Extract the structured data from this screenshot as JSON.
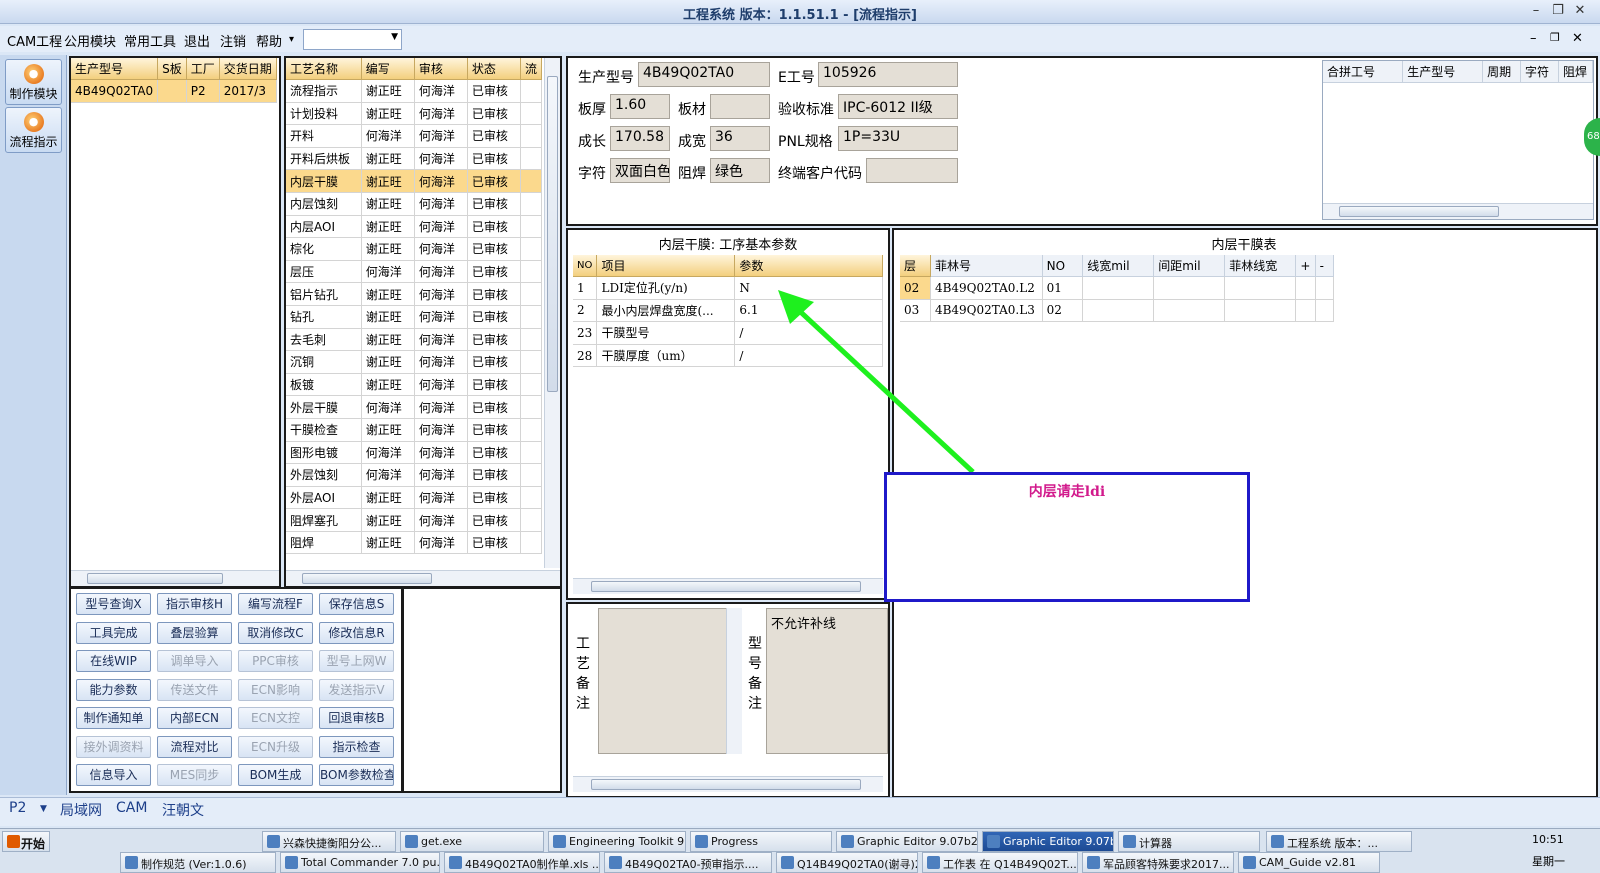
{
  "window": {
    "title": "工程系统   版本：1.1.51.1 - [流程指示]",
    "minimize": "–",
    "restore": "❐",
    "close": "✕"
  },
  "menu": {
    "items": [
      "CAM工程",
      "公用模块",
      "常用工具",
      "退出",
      "注销",
      "帮助"
    ],
    "dropdown_arrow": "▾",
    "combo_value": "",
    "mdi_min": "–",
    "mdi_restore": "❐",
    "mdi_close": "✕"
  },
  "sidebar": {
    "buttons": [
      {
        "label": "制作模块",
        "icon": "flame-icon"
      },
      {
        "label": "流程指示",
        "icon": "flow-icon"
      }
    ]
  },
  "orders": {
    "columns": [
      "生产型号",
      "S板",
      "工厂",
      "交货日期"
    ],
    "rows": [
      {
        "model": "4B49Q02TA0",
        "s": "",
        "factory": "P2",
        "date": "2017/3"
      }
    ]
  },
  "process": {
    "columns": [
      "工艺名称",
      "编写",
      "审核",
      "状态",
      "流"
    ],
    "rows": [
      [
        "流程指示",
        "谢正旺",
        "何海洋",
        "已审核"
      ],
      [
        "计划投料",
        "谢正旺",
        "何海洋",
        "已审核"
      ],
      [
        "开料",
        "何海洋",
        "何海洋",
        "已审核"
      ],
      [
        "开料后烘板",
        "谢正旺",
        "何海洋",
        "已审核"
      ],
      [
        "内层干膜",
        "谢正旺",
        "何海洋",
        "已审核"
      ],
      [
        "内层蚀刻",
        "谢正旺",
        "何海洋",
        "已审核"
      ],
      [
        "内层AOI",
        "谢正旺",
        "何海洋",
        "已审核"
      ],
      [
        "棕化",
        "谢正旺",
        "何海洋",
        "已审核"
      ],
      [
        "层压",
        "何海洋",
        "何海洋",
        "已审核"
      ],
      [
        "铝片钻孔",
        "谢正旺",
        "何海洋",
        "已审核"
      ],
      [
        "钻孔",
        "谢正旺",
        "何海洋",
        "已审核"
      ],
      [
        "去毛刺",
        "谢正旺",
        "何海洋",
        "已审核"
      ],
      [
        "沉铜",
        "谢正旺",
        "何海洋",
        "已审核"
      ],
      [
        "板镀",
        "谢正旺",
        "何海洋",
        "已审核"
      ],
      [
        "外层干膜",
        "何海洋",
        "何海洋",
        "已审核"
      ],
      [
        "干膜检查",
        "谢正旺",
        "何海洋",
        "已审核"
      ],
      [
        "图形电镀",
        "何海洋",
        "何海洋",
        "已审核"
      ],
      [
        "外层蚀刻",
        "何海洋",
        "何海洋",
        "已审核"
      ],
      [
        "外层AOI",
        "谢正旺",
        "何海洋",
        "已审核"
      ],
      [
        "阻焊塞孔",
        "谢正旺",
        "何海洋",
        "已审核"
      ],
      [
        "阻焊",
        "谢正旺",
        "何海洋",
        "已审核"
      ]
    ],
    "selected_index": 4
  },
  "actions": [
    {
      "label": "型号查询X",
      "enabled": true
    },
    {
      "label": "指示审核H",
      "enabled": true
    },
    {
      "label": "编写流程F",
      "enabled": true
    },
    {
      "label": "保存信息S",
      "enabled": true
    },
    {
      "label": "工具完成",
      "enabled": true
    },
    {
      "label": "叠层验算",
      "enabled": true
    },
    {
      "label": "取消修改C",
      "enabled": true
    },
    {
      "label": "修改信息R",
      "enabled": true
    },
    {
      "label": "在线WIP",
      "enabled": true
    },
    {
      "label": "调单导入",
      "enabled": false
    },
    {
      "label": "PPC审核",
      "enabled": false
    },
    {
      "label": "型号上网W",
      "enabled": false
    },
    {
      "label": "能力参数",
      "enabled": true
    },
    {
      "label": "传送文件",
      "enabled": false
    },
    {
      "label": "ECN影响",
      "enabled": false
    },
    {
      "label": "发送指示V",
      "enabled": false
    },
    {
      "label": "制作通知单",
      "enabled": true
    },
    {
      "label": "内部ECN",
      "enabled": true
    },
    {
      "label": "ECN文控",
      "enabled": false
    },
    {
      "label": "回退审核B",
      "enabled": true
    },
    {
      "label": "接外调资料",
      "enabled": false
    },
    {
      "label": "流程对比",
      "enabled": true
    },
    {
      "label": "ECN升级",
      "enabled": false
    },
    {
      "label": "指示检查",
      "enabled": true
    },
    {
      "label": "信息导入",
      "enabled": true
    },
    {
      "label": "MES同步",
      "enabled": false
    },
    {
      "label": "BOM生成",
      "enabled": true
    },
    {
      "label": "BOM参数检查",
      "enabled": true
    }
  ],
  "info": {
    "model_label": "生产型号",
    "model_value": "4B49Q02TA0",
    "e_label": "E工号",
    "e_value": "105926",
    "thickness_label": "板厚",
    "thickness_value": "1.60",
    "material_label": "板材",
    "material_value": "",
    "standard_label": "验收标准",
    "standard_value": "IPC-6012 II级",
    "length_label": "成长",
    "length_value": "170.58",
    "width_label": "成宽",
    "width_value": "36",
    "pnl_label": "PNL规格",
    "pnl_value": "1P=33U",
    "char_label": "字符",
    "char_value": "双面白色",
    "mask_label": "阻焊",
    "mask_value": "绿色",
    "customer_label": "终端客户代码",
    "customer_value": ""
  },
  "combined": {
    "columns": [
      "合拼工号",
      "生产型号",
      "周期",
      "字符",
      "阻焊"
    ],
    "badge": "68"
  },
  "params": {
    "title": "内层干膜: 工序基本参数",
    "columns": [
      "NO",
      "项目",
      "参数"
    ],
    "rows": [
      [
        "1",
        "LDI定位孔(y/n)",
        "N"
      ],
      [
        "2",
        "最小内层焊盘宽度(...",
        "6.1"
      ],
      [
        "23",
        "干膜型号",
        "/"
      ],
      [
        "28",
        "干膜厚度（um）",
        "/"
      ]
    ]
  },
  "film": {
    "title": "内层干膜表",
    "columns": [
      "层",
      "菲林号",
      "NO",
      "线宽mil",
      "间距mil",
      "菲林线宽",
      "+",
      "-"
    ],
    "rows": [
      [
        "02",
        "4B49Q02TA0.L2",
        "01"
      ],
      [
        "03",
        "4B49Q02TA0.L3",
        "02"
      ]
    ]
  },
  "notes": {
    "process_label": "工艺备注",
    "process_text": "",
    "model_label": "型号备注",
    "model_text": "不允许补线"
  },
  "annotation": {
    "text": "内层请走ldi",
    "arrow_color": "#1ef01e",
    "box_color": "#1f19c9",
    "text_color": "#d21a8c"
  },
  "statusbar": {
    "factory": "P2",
    "items": [
      "局域网",
      "CAM",
      "汪朝文"
    ]
  },
  "taskbar": {
    "start": "开始",
    "row1": [
      "兴森快捷衡阳分公...",
      "get.exe",
      "Engineering Toolkit 9....",
      "Progress",
      "Graphic Editor 9.07b2...",
      "Graphic Editor 9.07b2...",
      "计算器",
      "工程系统  版本：..."
    ],
    "row2": [
      "制作规范 (Ver:1.0.6)",
      "Total Commander 7.0 pu...",
      "4B49Q02TA0制作单.xls ...",
      "4B49Q02TA0-预审指示....",
      "Q14B49Q02TA0(谢寻)2...",
      "工作表 在 Q14B49Q02T...",
      "军品顾客特殊要求2017...",
      "CAM_Guide v2.81"
    ],
    "active_index": 5,
    "time": "10:51",
    "day": "星期一"
  }
}
